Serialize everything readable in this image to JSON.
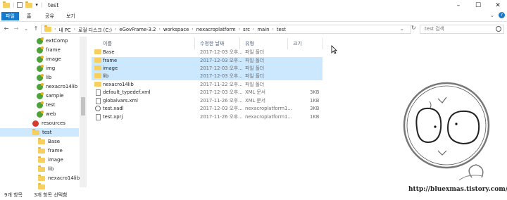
{
  "window": {
    "title": "test",
    "controls": {
      "minimize": "–",
      "maximize": "☐",
      "close": "✕"
    }
  },
  "ribbon": {
    "tabs": [
      {
        "label": "파일",
        "active": true
      },
      {
        "label": "홈",
        "active": false
      },
      {
        "label": "공유",
        "active": false
      },
      {
        "label": "보기",
        "active": false
      }
    ],
    "collapse_icon": "chevron-down-icon",
    "help_icon": "help-icon"
  },
  "navigation": {
    "back": "←",
    "forward": "→",
    "recent": "⌄",
    "up": "↑",
    "breadcrumb": [
      "내 PC",
      "로컬 디스크 (C:)",
      "eGovFrame-3.2",
      "workspace",
      "nexacroplatform",
      "src",
      "main",
      "test"
    ],
    "refresh": "↻",
    "search_placeholder": "test 검색"
  },
  "tree": [
    {
      "label": "extComp",
      "icon": "green"
    },
    {
      "label": "frame",
      "icon": "green"
    },
    {
      "label": "image",
      "icon": "green"
    },
    {
      "label": "img",
      "icon": "green"
    },
    {
      "label": "lib",
      "icon": "green"
    },
    {
      "label": "nexacro14lib",
      "icon": "green"
    },
    {
      "label": "sample",
      "icon": "green"
    },
    {
      "label": "test",
      "icon": "green"
    },
    {
      "label": "web",
      "icon": "green"
    },
    {
      "label": "resources",
      "icon": "red"
    },
    {
      "label": "test",
      "icon": "folder",
      "selected": true
    },
    {
      "label": "Base",
      "icon": "folder"
    },
    {
      "label": "frame",
      "icon": "folder"
    },
    {
      "label": "image",
      "icon": "folder"
    },
    {
      "label": "lib",
      "icon": "folder"
    },
    {
      "label": "nexacro14lib",
      "icon": "folder"
    },
    {
      "label": "",
      "icon": "folder"
    }
  ],
  "columns": {
    "name": "이름",
    "modified": "수정한 날짜",
    "type": "유형",
    "size": "크기"
  },
  "files": [
    {
      "name": "Base",
      "date": "2017-12-03 오후...",
      "type": "파일 폴더",
      "size": "",
      "icon": "folder",
      "selected": false
    },
    {
      "name": "frame",
      "date": "2017-12-03 오후...",
      "type": "파일 폴더",
      "size": "",
      "icon": "folder",
      "selected": true
    },
    {
      "name": "image",
      "date": "2017-12-03 오후...",
      "type": "파일 폴더",
      "size": "",
      "icon": "folder",
      "selected": true
    },
    {
      "name": "lib",
      "date": "2017-12-03 오후...",
      "type": "파일 폴더",
      "size": "",
      "icon": "folder",
      "selected": true
    },
    {
      "name": "nexacro14lib",
      "date": "2017-11-22 오후...",
      "type": "파일 폴더",
      "size": "",
      "icon": "folder",
      "selected": false
    },
    {
      "name": "default_typedef.xml",
      "date": "2017-12-03 오후...",
      "type": "XML 문서",
      "size": "3KB",
      "icon": "file",
      "selected": false
    },
    {
      "name": "globalvars.xml",
      "date": "2017-11-26 오후...",
      "type": "XML 문서",
      "size": "1KB",
      "icon": "file",
      "selected": false
    },
    {
      "name": "test.xadl",
      "date": "2017-12-03 오후...",
      "type": "nexacroplatform1...",
      "size": "3KB",
      "icon": "gear",
      "selected": false
    },
    {
      "name": "test.xprj",
      "date": "2017-11-26 오후...",
      "type": "nexacroplatform1...",
      "size": "1KB",
      "icon": "file",
      "selected": false
    }
  ],
  "status": {
    "count": "9개 항목",
    "selected": "3개 항목 선택함"
  },
  "watermark": {
    "url": "http://bluexmas.tistory.com/"
  }
}
